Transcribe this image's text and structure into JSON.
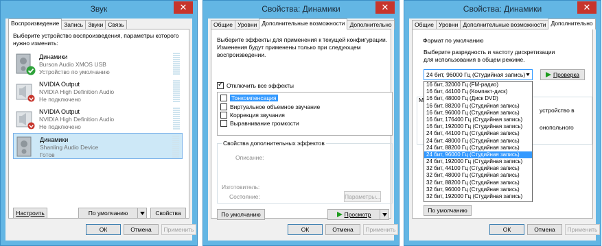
{
  "win1": {
    "title": "Звук",
    "close": "✕",
    "tabs": [
      "Воспроизведение",
      "Запись",
      "Звуки",
      "Связь"
    ],
    "instruction": "Выберите устройство воспроизведения, параметры которого нужно изменить:",
    "devices": [
      {
        "name": "Динамики",
        "desc": "Burson Audio XMOS USB",
        "status": "Устройство по умолчанию",
        "badge": "check"
      },
      {
        "name": "NVIDIA Output",
        "desc": "NVIDIA High Definition Audio",
        "status": "Не подключено",
        "badge": "down"
      },
      {
        "name": "NVIDIA Output",
        "desc": "NVIDIA High Definition Audio",
        "status": "Не подключено",
        "badge": "down"
      },
      {
        "name": "Динамики",
        "desc": "Shanling Audio Device",
        "status": "Готов",
        "badge": "none"
      }
    ],
    "configure": "Настроить",
    "set_default": "По умолчанию",
    "properties": "Свойства",
    "ok": "ОК",
    "cancel": "Отмена",
    "apply": "Применить"
  },
  "win2": {
    "title": "Свойства: Динамики",
    "close": "✕",
    "tabs": [
      "Общие",
      "Уровни",
      "Дополнительные возможности",
      "Дополнительно"
    ],
    "instruction": "Выберите эффекты для применения к текущей конфигурации. Изменения будут применены только при следующем воспроизведении.",
    "disable_all": "Отключить все эффекты",
    "effects": [
      "Тонкомпенсация",
      "Виртуальное объемное звучание",
      "Коррекция звучания",
      "Выравнивание громкости"
    ],
    "props_group": "Свойства дополнительных эффектов",
    "desc_label": "Описание:",
    "vendor_label": "Изготовитель:",
    "state_label": "Состояние:",
    "settings_btn": "Параметры...",
    "restore_defaults": "По умолчанию",
    "preview": "Просмотр",
    "ok": "ОК",
    "cancel": "Отмена",
    "apply": "Применить"
  },
  "win3": {
    "title": "Свойства: Динамики",
    "close": "✕",
    "tabs": [
      "Общие",
      "Уровни",
      "Дополнительные возможности",
      "Дополнительно"
    ],
    "format_group": "Формат по умолчанию",
    "instruction": "Выберите разрядность и частоту дискретизации для использования в общем режиме.",
    "selected_format": "24 бит, 96000 Гц (Студийная запись)",
    "check_btn": "Проверка",
    "formats": [
      "16 бит, 32000 Гц (FM-радио)",
      "16 бит, 44100 Гц (Компакт-диск)",
      "16 бит, 48000 Гц (Диск DVD)",
      "16 бит, 88200 Гц (Студийная запись)",
      "16 бит, 96000 Гц (Студийная запись)",
      "16 бит, 176400 Гц (Студийная запись)",
      "16 бит, 192000 Гц (Студийная запись)",
      "24 бит, 44100 Гц (Студийная запись)",
      "24 бит, 48000 Гц (Студийная запись)",
      "24 бит, 88200 Гц (Студийная запись)",
      "24 бит, 96000 Гц (Студийная запись)",
      "24 бит, 192000 Гц (Студийная запись)",
      "32 бит, 44100 Гц (Студийная запись)",
      "32 бит, 48000 Гц (Студийная запись)",
      "32 бит, 88200 Гц (Студийная запись)",
      "32 бит, 96000 Гц (Студийная запись)",
      "32 бит, 192000 Гц (Студийная запись)"
    ],
    "selected_index": 10,
    "partial_m": "М",
    "partial_line1": "устройство в",
    "partial_line2": "онопольного",
    "restore_defaults": "По умолчанию",
    "ok": "ОК",
    "cancel": "Отмена",
    "apply": "Применить"
  }
}
